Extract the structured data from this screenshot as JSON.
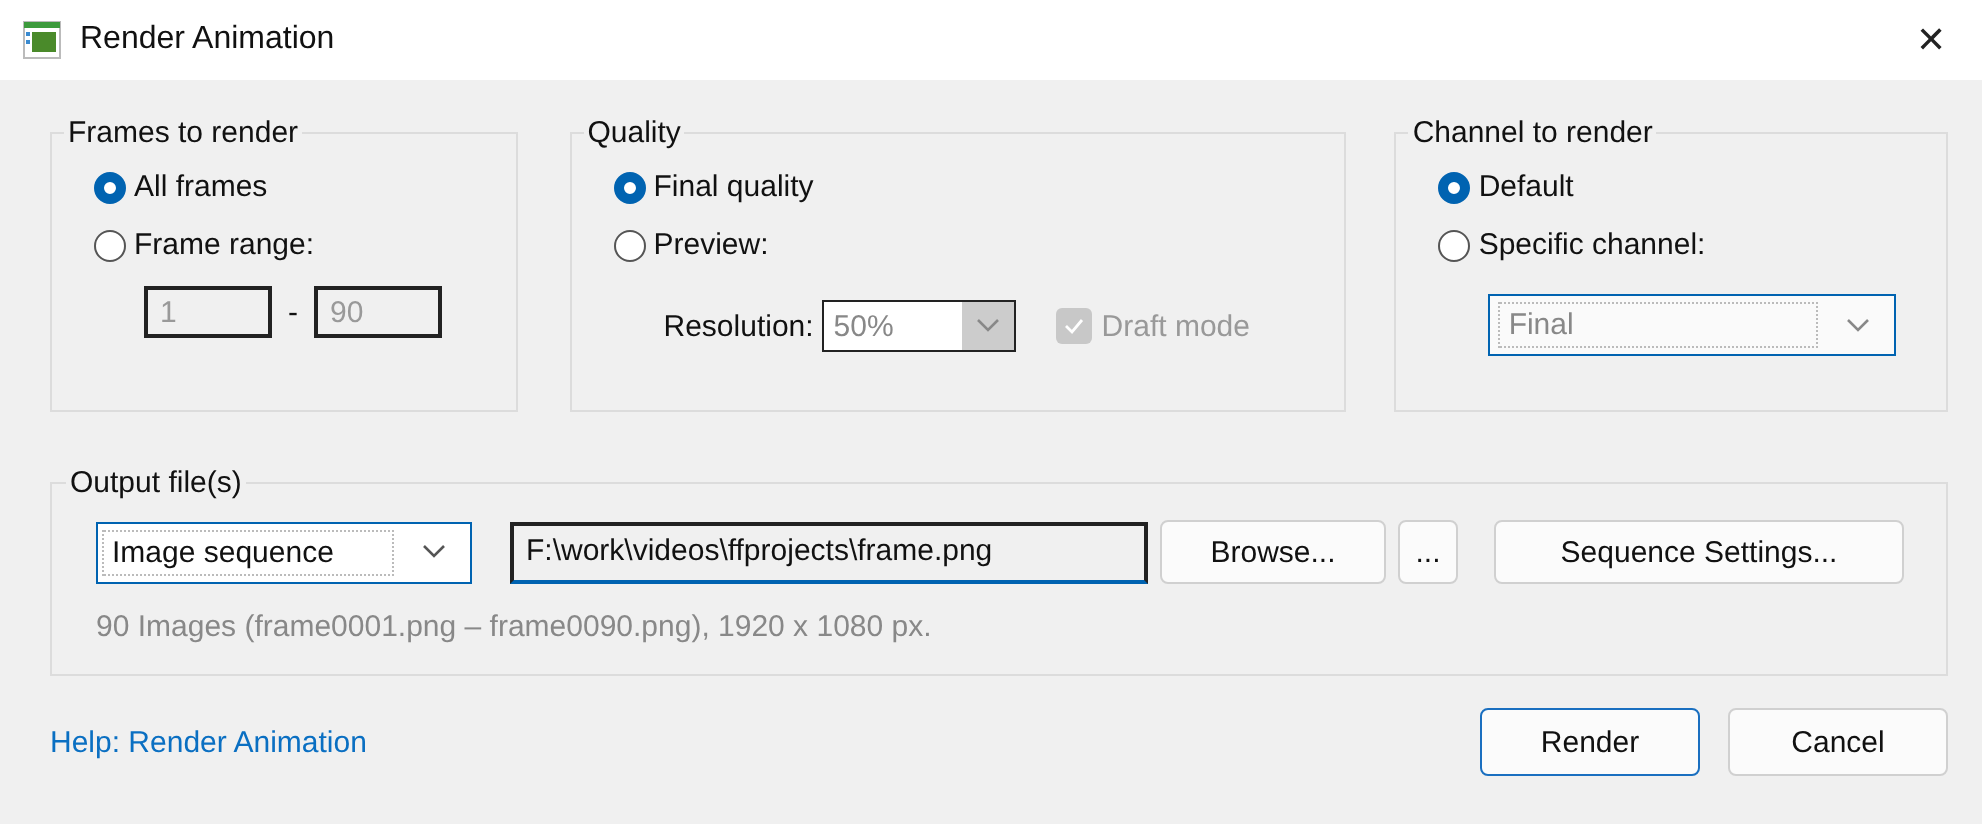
{
  "window": {
    "title": "Render Animation",
    "close": "✕"
  },
  "frames": {
    "title": "Frames to render",
    "options": [
      {
        "label": "All frames",
        "selected": true
      },
      {
        "label": "Frame range:",
        "selected": false
      }
    ],
    "range": {
      "from": "1",
      "separator": "-",
      "to": "90",
      "disabled": true
    }
  },
  "quality": {
    "title": "Quality",
    "options": [
      {
        "label": "Final quality",
        "selected": true
      },
      {
        "label": "Preview:",
        "selected": false
      }
    ],
    "resolution": {
      "label": "Resolution:",
      "value": "50%",
      "disabled": true
    },
    "draft": {
      "label": "Draft mode",
      "checked": true,
      "disabled": true
    }
  },
  "channel": {
    "title": "Channel to render",
    "options": [
      {
        "label": "Default",
        "selected": true
      },
      {
        "label": "Specific channel:",
        "selected": false
      }
    ],
    "select": {
      "value": "Final",
      "disabled": true
    }
  },
  "output": {
    "title": "Output file(s)",
    "type_select": {
      "value": "Image sequence"
    },
    "path": {
      "value": "F:\\work\\videos\\ffprojects\\frame.png"
    },
    "buttons": [
      {
        "label": "Browse...",
        "kind": "browse"
      },
      {
        "label": "...",
        "kind": "more"
      },
      {
        "label": "Sequence Settings...",
        "kind": "settings"
      }
    ],
    "info": "90 Images (frame0001.png – frame0090.png), 1920 x 1080 px."
  },
  "footer": {
    "help_link": "Help: Render Animation",
    "buttons": [
      {
        "label": "Render",
        "default": true
      },
      {
        "label": "Cancel",
        "default": false
      }
    ]
  }
}
